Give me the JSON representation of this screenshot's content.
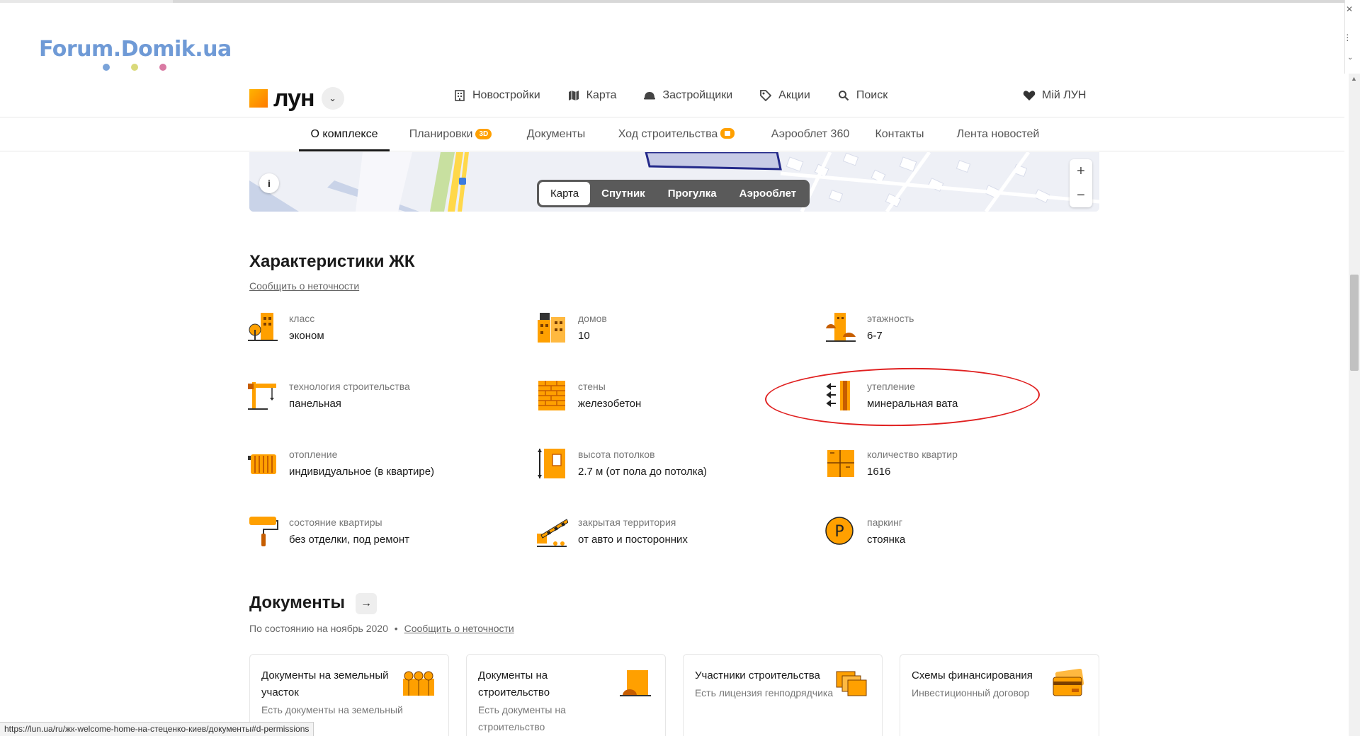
{
  "watermark": {
    "text": "Forum.Domik.ua",
    "dot_colors": [
      "#7aa3d9",
      "#d9d97a",
      "#d97aa3"
    ]
  },
  "header": {
    "logo_text": "лун",
    "nav": [
      {
        "label": "Новостройки",
        "icon": "building-icon"
      },
      {
        "label": "Карта",
        "icon": "map-icon"
      },
      {
        "label": "Застройщики",
        "icon": "helmet-icon"
      },
      {
        "label": "Акции",
        "icon": "tag-icon"
      },
      {
        "label": "Поиск",
        "icon": "search-icon"
      }
    ],
    "my_lun": "Мій ЛУН"
  },
  "tabs": [
    {
      "label": "О комплексе",
      "active": true
    },
    {
      "label": "Планировки",
      "badge": "3D"
    },
    {
      "label": "Документы"
    },
    {
      "label": "Ход строительства",
      "badge_icon": "camera-icon"
    },
    {
      "label": "Аэрооблет 360"
    },
    {
      "label": "Контакты"
    },
    {
      "label": "Лента новостей"
    }
  ],
  "map": {
    "switch": [
      "Карта",
      "Спутник",
      "Прогулка",
      "Аэрооблет"
    ],
    "selected": "Карта",
    "zoom_in": "+",
    "zoom_out": "−",
    "info": "i"
  },
  "characteristics": {
    "title": "Характеристики ЖК",
    "report_link": "Сообщить о неточности",
    "items": [
      {
        "label": "класс",
        "value": "эконом",
        "icon": "class-icon"
      },
      {
        "label": "домов",
        "value": "10",
        "icon": "houses-icon"
      },
      {
        "label": "этажность",
        "value": "6-7",
        "icon": "floors-icon"
      },
      {
        "label": "технология строительства",
        "value": "панельная",
        "icon": "crane-icon"
      },
      {
        "label": "стены",
        "value": "железобетон",
        "icon": "wall-icon"
      },
      {
        "label": "утепление",
        "value": "минеральная вата",
        "icon": "insulation-icon"
      },
      {
        "label": "отопление",
        "value": "индивидуальное (в квартире)",
        "icon": "radiator-icon"
      },
      {
        "label": "высота потолков",
        "value": "2.7 м (от пола до потолка)",
        "icon": "ceiling-height-icon"
      },
      {
        "label": "количество квартир",
        "value": "1616",
        "icon": "apartments-icon"
      },
      {
        "label": "состояние квартиры",
        "value": "без отделки, под ремонт",
        "icon": "paint-roller-icon"
      },
      {
        "label": "закрытая территория",
        "value": "от авто и посторонних",
        "icon": "barrier-icon"
      },
      {
        "label": "паркинг",
        "value": "стоянка",
        "icon": "parking-icon"
      }
    ]
  },
  "documents": {
    "title": "Документы",
    "status": "По состоянию на ноябрь 2020",
    "separator": "•",
    "report_link": "Сообщить о неточности",
    "cards": [
      {
        "title": "Документы на земельный участок",
        "desc": "Есть документы на земельный участок",
        "icon": "land-docs-icon"
      },
      {
        "title": "Документы на строительство",
        "desc": "Есть документы на строительство",
        "icon": "construction-docs-icon"
      },
      {
        "title": "Участники строительства",
        "desc": "Есть лицензия генподрядчика",
        "icon": "participants-icon"
      },
      {
        "title": "Схемы финансирования",
        "desc": "Инвестиционный договор",
        "icon": "financing-icon"
      }
    ]
  },
  "statusbar": {
    "url": "https://lun.ua/ru/жк-welcome-home-на-стеценко-киев/документы#d-permissions"
  },
  "colors": {
    "accent": "#ffa000",
    "annotation": "#e02020"
  }
}
